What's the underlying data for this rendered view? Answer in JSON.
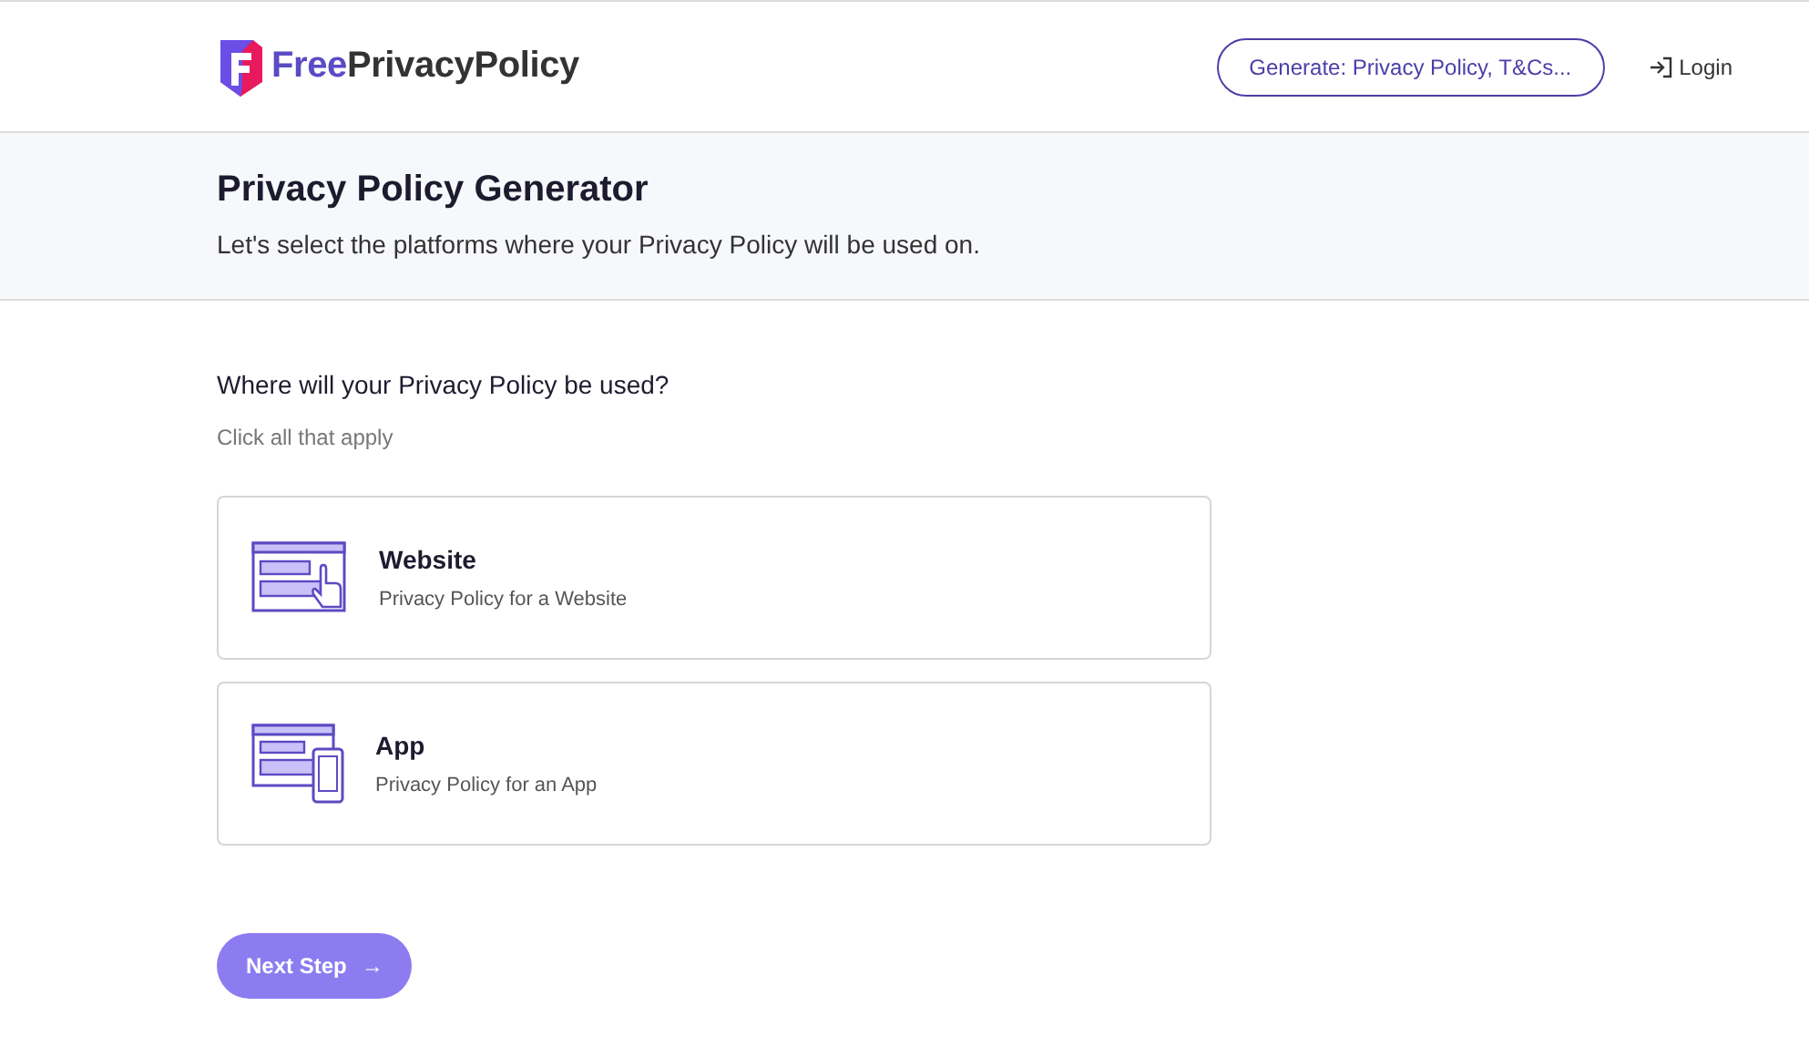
{
  "header": {
    "logo": {
      "accent": "Free",
      "rest": "PrivacyPolicy"
    },
    "generate_button": "Generate: Privacy Policy, T&Cs...",
    "login": "Login"
  },
  "hero": {
    "title": "Privacy Policy Generator",
    "subtitle": "Let's select the platforms where your Privacy Policy will be used on."
  },
  "question": {
    "title": "Where will your Privacy Policy be used?",
    "hint": "Click all that apply"
  },
  "options": [
    {
      "kind": "website",
      "title": "Website",
      "description": "Privacy Policy for a Website",
      "selected": false
    },
    {
      "kind": "app",
      "title": "App",
      "description": "Privacy Policy for an App",
      "selected": false
    }
  ],
  "next_button": {
    "label": "Next Step",
    "arrow": "→"
  }
}
